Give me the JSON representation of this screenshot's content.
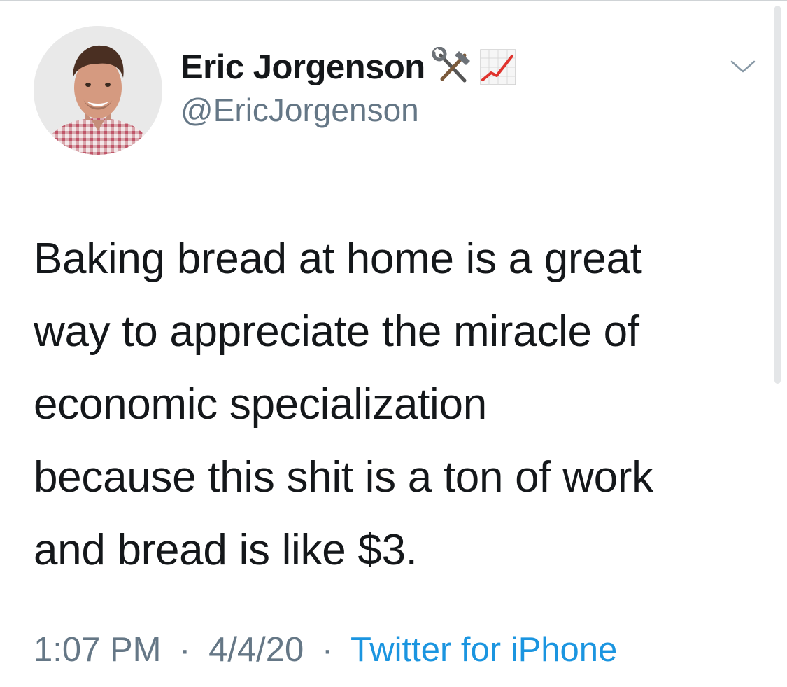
{
  "author": {
    "display_name": "Eric Jorgenson",
    "handle": "@EricJorgenson",
    "badges": [
      "hammer-and-wrench-icon",
      "chart-increasing-icon"
    ]
  },
  "tweet": {
    "lines": [
      "Baking bread at home is a great",
      "way to appreciate the miracle of",
      "economic specialization",
      "because this shit is a ton of work",
      "and bread is like $3."
    ]
  },
  "meta": {
    "time": "1:07 PM",
    "separator": "·",
    "date": "4/4/20",
    "source": "Twitter for iPhone"
  },
  "colors": {
    "text": "#14171a",
    "secondary": "#657786",
    "link": "#1b95e0"
  }
}
